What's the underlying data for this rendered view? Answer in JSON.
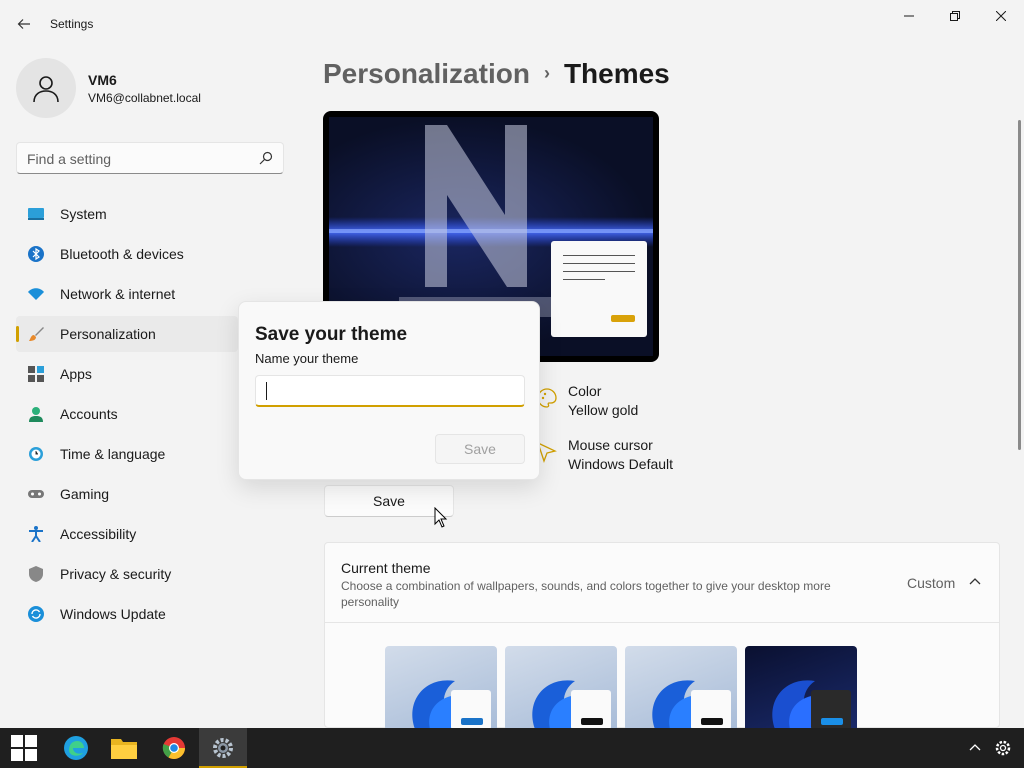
{
  "window": {
    "title": "Settings",
    "back_icon": "back-arrow-icon",
    "minimize_icon": "minimize-icon",
    "maximize_icon": "restore-icon",
    "close_icon": "close-icon"
  },
  "user": {
    "name": "VM6",
    "email": "VM6@collabnet.local",
    "avatar_icon": "person-icon"
  },
  "search": {
    "placeholder": "Find a setting",
    "icon": "search-icon"
  },
  "sidebar": {
    "items": [
      {
        "label": "System",
        "icon": "system-icon",
        "selected": false
      },
      {
        "label": "Bluetooth & devices",
        "icon": "bluetooth-icon",
        "selected": false
      },
      {
        "label": "Network & internet",
        "icon": "wifi-icon",
        "selected": false
      },
      {
        "label": "Personalization",
        "icon": "brush-icon",
        "selected": true
      },
      {
        "label": "Apps",
        "icon": "apps-icon",
        "selected": false
      },
      {
        "label": "Accounts",
        "icon": "accounts-icon",
        "selected": false
      },
      {
        "label": "Time & language",
        "icon": "time-language-icon",
        "selected": false
      },
      {
        "label": "Gaming",
        "icon": "gamepad-icon",
        "selected": false
      },
      {
        "label": "Accessibility",
        "icon": "accessibility-icon",
        "selected": false
      },
      {
        "label": "Privacy & security",
        "icon": "shield-icon",
        "selected": false
      },
      {
        "label": "Windows Update",
        "icon": "update-icon",
        "selected": false
      }
    ]
  },
  "header": {
    "parent": "Personalization",
    "separator": "›",
    "current": "Themes"
  },
  "details": {
    "color_title": "Color",
    "color_value": "Yellow gold",
    "cursor_title": "Mouse cursor",
    "cursor_value": "Windows Default"
  },
  "save_button_label": "Save",
  "dialog": {
    "title": "Save your theme",
    "label": "Name your theme",
    "input_value": "",
    "save_label": "Save"
  },
  "current_theme": {
    "title": "Current theme",
    "description": "Choose a combination of wallpapers, sounds, and colors together to give your desktop more personality",
    "value": "Custom",
    "chevron_icon": "chevron-up-icon"
  },
  "colors": {
    "accent": "#d1a000",
    "taskbar": "#1f1f1f",
    "background": "#f3f3f3"
  },
  "taskbar": {
    "apps": [
      "start-icon",
      "edge-icon",
      "file-explorer-icon",
      "chrome-icon",
      "settings-icon"
    ],
    "active_app": "settings-icon",
    "tray": [
      "chevron-up-icon",
      "gear-icon"
    ]
  }
}
